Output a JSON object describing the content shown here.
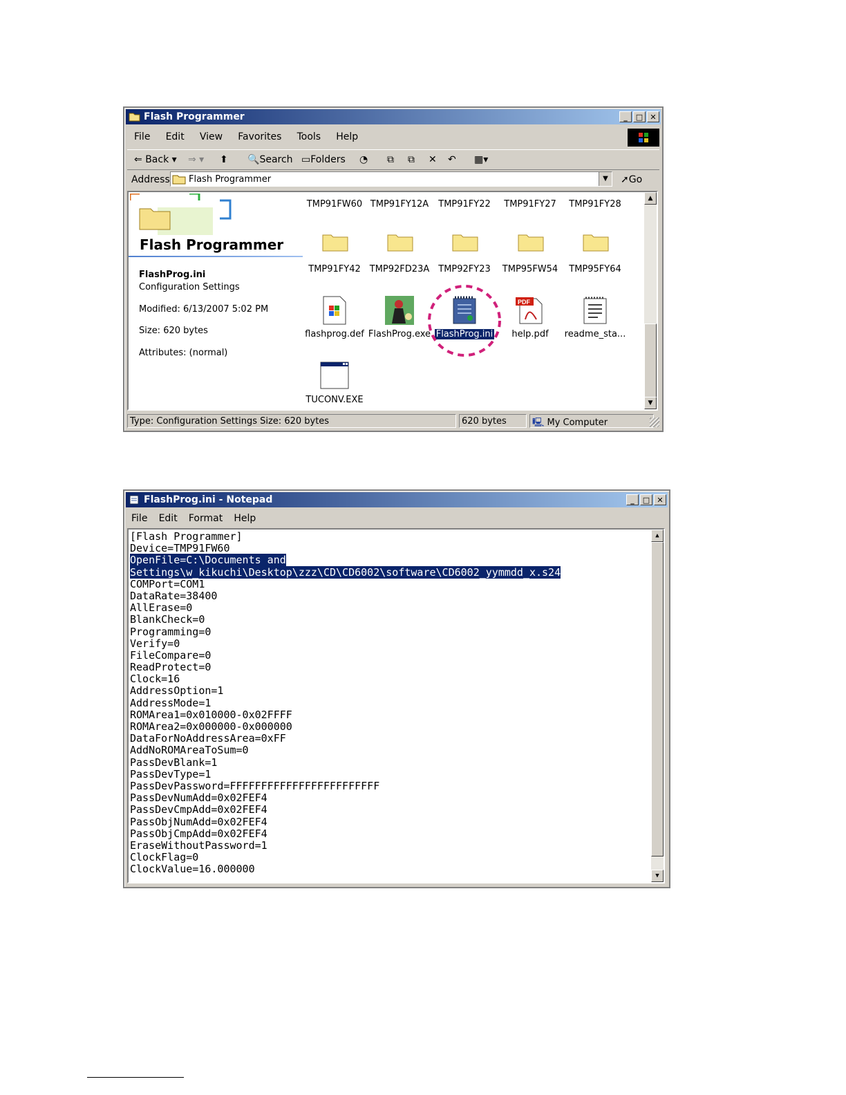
{
  "explorer": {
    "title": "Flash Programmer",
    "menu": [
      "File",
      "Edit",
      "View",
      "Favorites",
      "Tools",
      "Help"
    ],
    "toolbar": {
      "back": "Back",
      "search": "Search",
      "folders": "Folders"
    },
    "address": {
      "label": "Address",
      "value": "Flash Programmer",
      "go": "Go"
    },
    "sidepanel": {
      "folder_title": "Flash Programmer",
      "file_name": "FlashProg.ini",
      "file_type": "Configuration Settings",
      "modified": "Modified: 6/13/2007 5:02 PM",
      "size": "Size: 620 bytes",
      "attributes": "Attributes: (normal)"
    },
    "row1_labels": [
      "TMP91FW60",
      "TMP91FY12A",
      "TMP91FY22",
      "TMP91FY27",
      "TMP91FY28"
    ],
    "folders": [
      "TMP91FY42",
      "TMP92FD23A",
      "TMP92FY23",
      "TMP95FW54",
      "TMP95FY64"
    ],
    "files": [
      "flashprog.def",
      "FlashProg.exe",
      "FlashProg.ini",
      "help.pdf",
      "readme_sta..."
    ],
    "last_file": "TUCONV.EXE",
    "status": {
      "type": "Type: Configuration Settings Size: 620 bytes",
      "size": "620 bytes",
      "zone": "My Computer"
    }
  },
  "notepad": {
    "title": "FlashProg.ini - Notepad",
    "menu": [
      "File",
      "Edit",
      "Format",
      "Help"
    ],
    "lines": [
      "[Flash Programmer]",
      "Device=TMP91FW60",
      "OpenFile=C:\\Documents and",
      "Settings\\w_kikuchi\\Desktop\\zzz\\CD\\CD6002\\software\\CD6002_yymmdd_x.s24",
      "COMPort=COM1",
      "DataRate=38400",
      "AllErase=0",
      "BlankCheck=0",
      "Programming=0",
      "Verify=0",
      "FileCompare=0",
      "ReadProtect=0",
      "Clock=16",
      "AddressOption=1",
      "AddressMode=1",
      "ROMArea1=0x010000-0x02FFFF",
      "ROMArea2=0x000000-0x000000",
      "DataForNoAddressArea=0xFF",
      "AddNoROMAreaToSum=0",
      "PassDevBlank=1",
      "PassDevType=1",
      "PassDevPassword=FFFFFFFFFFFFFFFFFFFFFFFF",
      "PassDevNumAdd=0x02FEF4",
      "PassDevCmpAdd=0x02FEF4",
      "PassObjNumAdd=0x02FEF4",
      "PassObjCmpAdd=0x02FEF4",
      "EraseWithoutPassword=1",
      "ClockFlag=0",
      "ClockValue=16.000000"
    ]
  }
}
